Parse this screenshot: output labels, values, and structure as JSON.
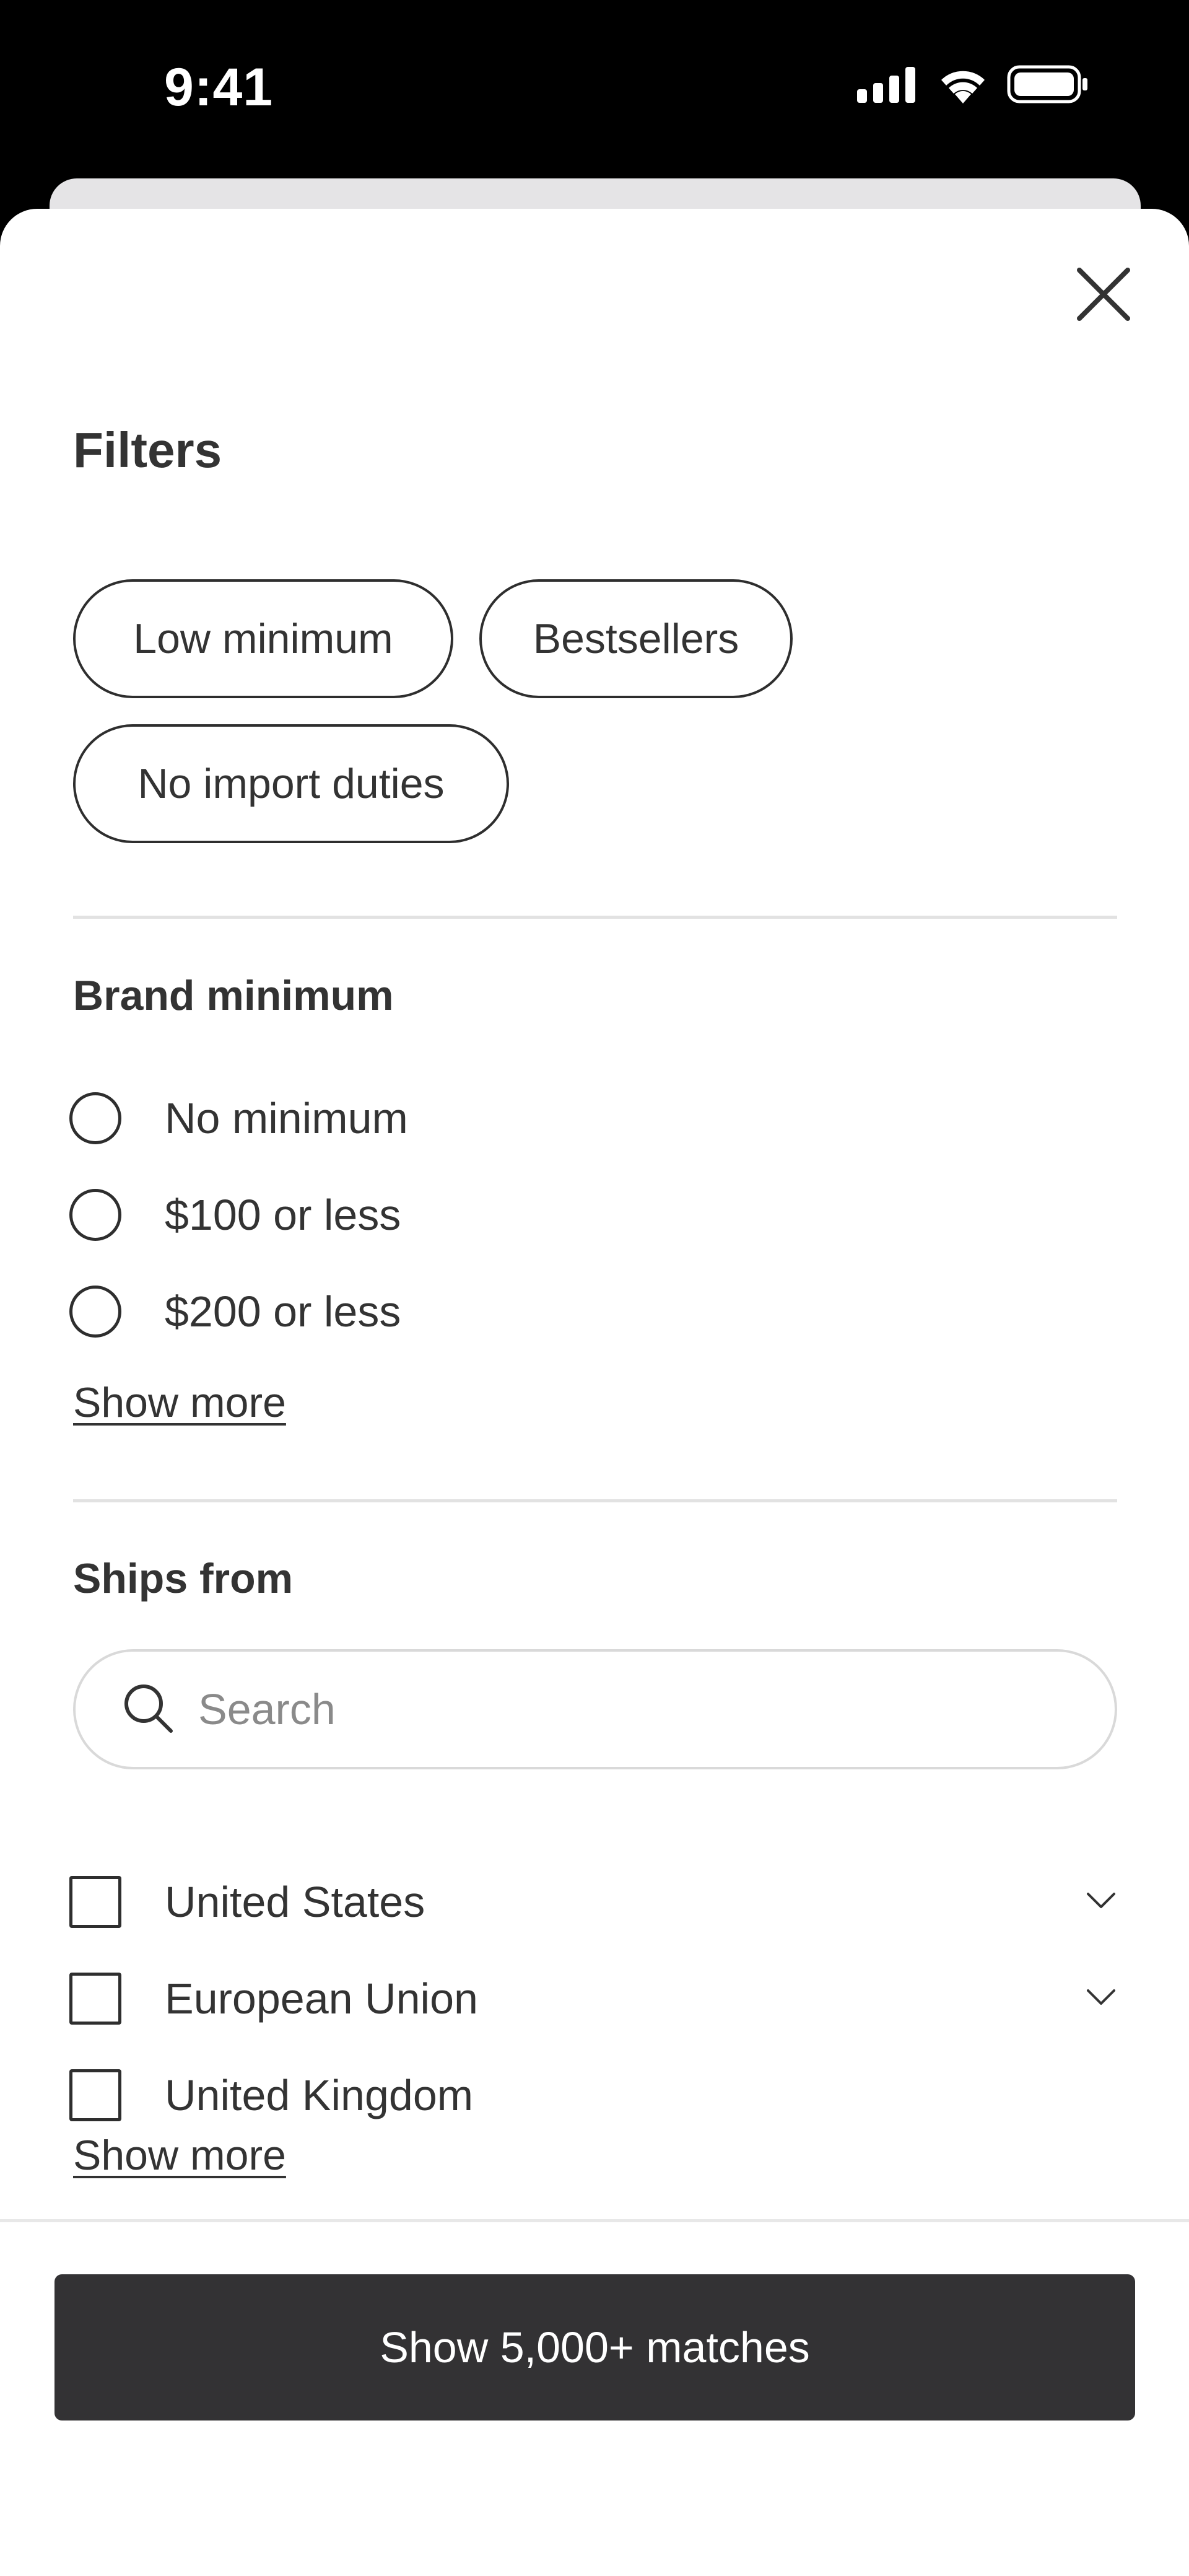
{
  "status_bar": {
    "time": "9:41",
    "icons": [
      "cellular-signal-icon",
      "wifi-icon",
      "battery-icon"
    ]
  },
  "sheet": {
    "close_icon": "close-icon",
    "title": "Filters"
  },
  "quick_filters": [
    {
      "label": "Low minimum"
    },
    {
      "label": "Bestsellers"
    },
    {
      "label": "No import duties"
    }
  ],
  "brand_minimum": {
    "title": "Brand minimum",
    "options": [
      {
        "label": "No minimum",
        "selected": false
      },
      {
        "label": "$100 or less",
        "selected": false
      },
      {
        "label": "$200 or less",
        "selected": false
      }
    ],
    "show_more": "Show more"
  },
  "ships_from": {
    "title": "Ships from",
    "search_placeholder": "Search",
    "search_value": "",
    "options": [
      {
        "label": "United States",
        "checked": false,
        "expandable": true
      },
      {
        "label": "European Union",
        "checked": false,
        "expandable": true
      },
      {
        "label": "United Kingdom",
        "checked": false,
        "expandable": false
      }
    ],
    "show_more": "Show more"
  },
  "footer": {
    "primary_button": "Show 5,000+ matches"
  },
  "colors": {
    "text": "#333333",
    "button_bg": "#333234",
    "divider": "#e2e2e2",
    "status_bar_bg": "#000000"
  }
}
